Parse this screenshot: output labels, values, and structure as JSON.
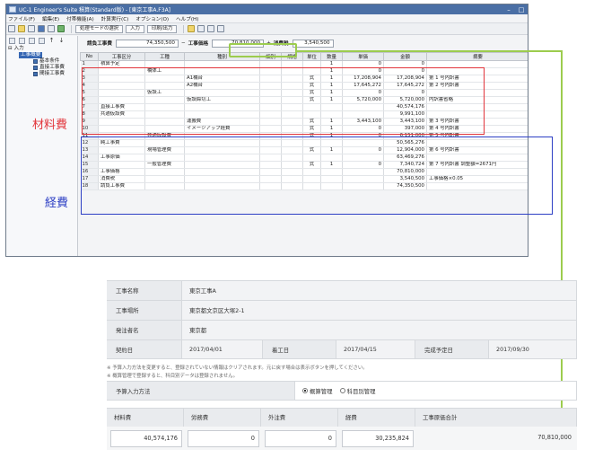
{
  "window": {
    "title": "UC-1 Engineer's Suite 積算(Standard版) - [東京工事A.F3A]",
    "minimize": "–",
    "maximize": "□"
  },
  "menu": [
    "ファイル(F)",
    "編集(E)",
    "付帯機能(A)",
    "計算実行(C)",
    "オプション(O)",
    "ヘルプ(H)"
  ],
  "toolbar": {
    "mode_label": "処理モードの選択",
    "input_label": "入力",
    "print_label": "印刷/出力"
  },
  "tree": {
    "root": "入力",
    "selected": "工事概要",
    "items": [
      "基本条件",
      "直接工事費",
      "間接工事費"
    ]
  },
  "summary": {
    "direct_label": "請負工事費",
    "direct_value": "74,350,500",
    "op_minus": "−",
    "cost_label": "工事価格",
    "cost_value": "70,810,000",
    "op_plus": "+",
    "tax_label": "消費税",
    "tax_value": "3,540,500"
  },
  "grid": {
    "headers": [
      "No",
      "工事区分",
      "工種",
      "種別",
      "細別",
      "規格",
      "単位",
      "数量",
      "単価",
      "金額",
      "摘要"
    ],
    "rows": [
      [
        "1",
        "積算予定",
        "",
        "",
        "",
        "",
        "",
        "1",
        "0",
        "0",
        ""
      ],
      [
        "2",
        "",
        "橋体工",
        "",
        "",
        "",
        "",
        "1",
        "0",
        "0",
        ""
      ],
      [
        "3",
        "",
        "",
        "A1橋台",
        "",
        "",
        "式",
        "1",
        "17,208,904",
        "17,208,904",
        "第 1 号内訳書"
      ],
      [
        "4",
        "",
        "",
        "A2橋台",
        "",
        "",
        "式",
        "1",
        "17,645,272",
        "17,645,272",
        "第 2 号内訳書"
      ],
      [
        "5",
        "",
        "仮設工",
        "",
        "",
        "",
        "式",
        "1",
        "0",
        "0",
        ""
      ],
      [
        "6",
        "",
        "",
        "仮設締切工",
        "",
        "",
        "式",
        "1",
        "5,720,000",
        "5,720,000",
        "内訳書省略"
      ],
      [
        "7",
        "直接工事費",
        "",
        "",
        "",
        "",
        "",
        "",
        "",
        "40,574,176",
        ""
      ],
      [
        "8",
        "共通仮設費",
        "",
        "",
        "",
        "",
        "",
        "",
        "",
        "9,991,100",
        ""
      ],
      [
        "9",
        "",
        "",
        "運搬費",
        "",
        "",
        "式",
        "1",
        "3,443,100",
        "3,443,100",
        "第 3 号内訳書"
      ],
      [
        "10",
        "",
        "",
        "イメージアップ経費",
        "",
        "",
        "式",
        "1",
        "0",
        "397,000",
        "第 4 号内訳書"
      ],
      [
        "11",
        "",
        "共通仮設費",
        "",
        "",
        "",
        "式",
        "1",
        "0",
        "6,151,000",
        "第 5 号内訳書"
      ],
      [
        "12",
        "純工事費",
        "",
        "",
        "",
        "",
        "",
        "",
        "",
        "50,565,276",
        ""
      ],
      [
        "13",
        "",
        "現場管理費",
        "",
        "",
        "",
        "式",
        "1",
        "0",
        "12,904,000",
        "第 6 号内訳書"
      ],
      [
        "14",
        "工事原価",
        "",
        "",
        "",
        "",
        "",
        "",
        "",
        "63,469,276",
        ""
      ],
      [
        "15",
        "",
        "一般管理費",
        "",
        "",
        "",
        "式",
        "1",
        "0",
        "7,340,724",
        "第 7 号内訳書 調整額=2671円"
      ],
      [
        "16",
        "工事価格",
        "",
        "",
        "",
        "",
        "",
        "",
        "",
        "70,810,000",
        ""
      ],
      [
        "17",
        "消費税",
        "",
        "",
        "",
        "",
        "",
        "",
        "",
        "3,540,500",
        "工事価格×0.05"
      ],
      [
        "18",
        "請負工事費",
        "",
        "",
        "",
        "",
        "",
        "",
        "",
        "74,350,500",
        ""
      ]
    ]
  },
  "annotations": {
    "materials": "材料費",
    "expenses": "経費"
  },
  "form": {
    "construction_name_label": "工事名称",
    "construction_name": "東京工事A",
    "site_label": "工事場所",
    "site": "東京都文京区大塚2-1",
    "client_label": "発注者名",
    "client": "東京都",
    "contract_date_label": "契約日",
    "contract_date": "2017/04/01",
    "start_label": "着工日",
    "start_date": "2017/04/15",
    "complete_label": "完成予定日",
    "complete_date": "2017/09/30",
    "note1": "※ 予算入力方法を変更すると、登録されていない情報はクリアされます。元に戻す場合は表示ボタンを押してください。",
    "note2": "※ 概算管理で登録すると、科目別データは登録されません。",
    "budget_method_label": "予算入力方法",
    "radio_rough": "概算管理",
    "radio_item": "科目別管理",
    "materials_label": "材料費",
    "labor_label": "労務費",
    "outsource_label": "外注費",
    "expense_label": "経費",
    "total_label": "工事原価合計",
    "materials_value": "40,574,176",
    "labor_value": "0",
    "outsource_value": "0",
    "expense_value": "30,235,824",
    "total_value": "70,810,000"
  },
  "colors": {
    "red_box": "#e2363c",
    "blue_box": "#2d3fc4",
    "green_box": "#9ccc4e"
  }
}
